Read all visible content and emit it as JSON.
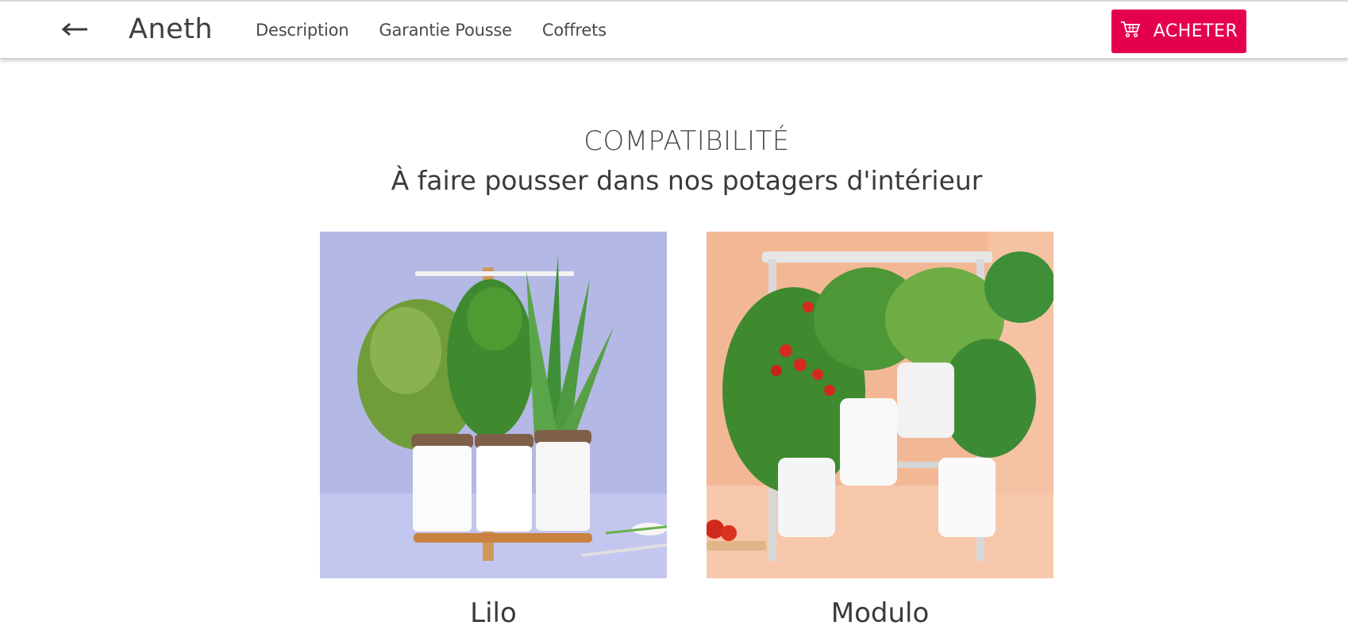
{
  "header": {
    "back_icon": "arrow-left-icon",
    "title": "Aneth",
    "nav": [
      "Description",
      "Garantie Pousse",
      "Coffrets"
    ],
    "buy_label": "ACHETER",
    "buy_icon": "shopping-cart-icon",
    "accent_color": "#e5004f"
  },
  "section": {
    "kicker": "COMPATIBILITÉ",
    "title": "À faire pousser dans nos potagers d'intérieur"
  },
  "products": [
    {
      "name": "Lilo",
      "background_color": "#b3b8e4"
    },
    {
      "name": "Modulo",
      "background_color": "#f2b896"
    }
  ]
}
